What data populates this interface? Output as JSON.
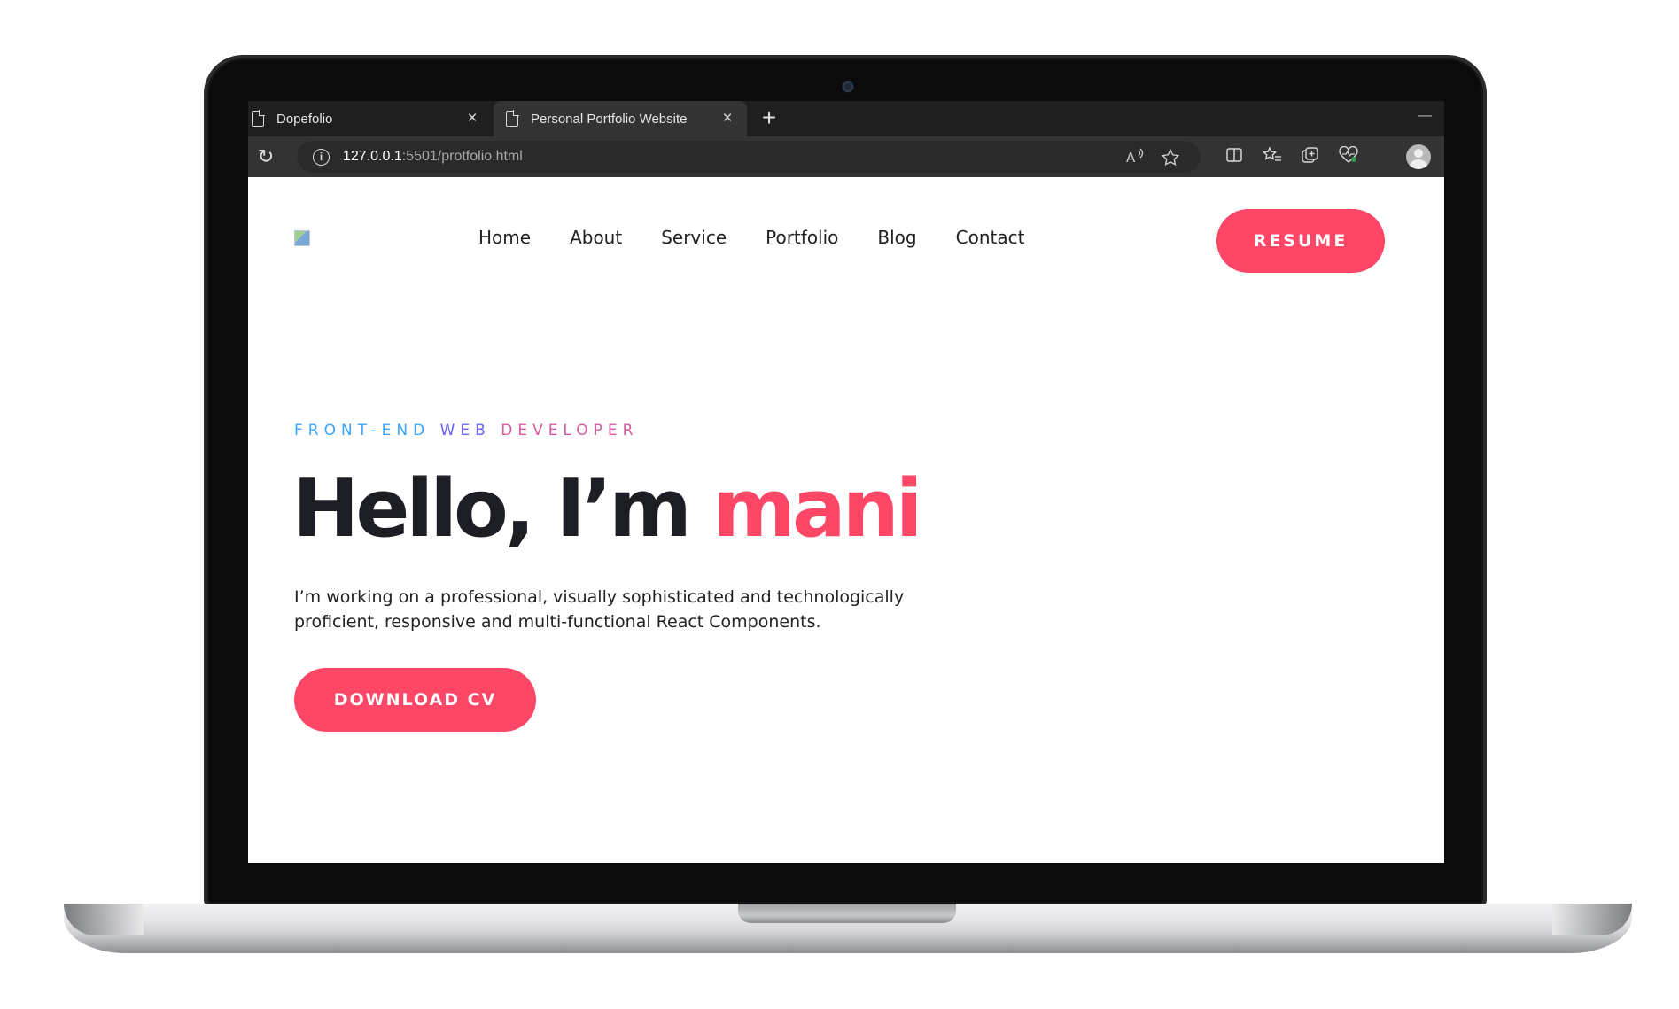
{
  "browser": {
    "tabs": [
      {
        "title": "Dopefolio",
        "close": "×"
      },
      {
        "title": "Personal Portfolio Website",
        "close": "×"
      }
    ],
    "new_tab": "+",
    "minimize": "—",
    "url": {
      "host": "127.0.0.1",
      "rest": ":5501/protfolio.html"
    },
    "reload_glyph": "↻",
    "info_glyph": "i",
    "icons": [
      "read-aloud-icon",
      "favorite-star-icon",
      "split-screen-icon",
      "favorites-list-icon",
      "collections-icon",
      "browser-essentials-icon",
      "profile-avatar-icon"
    ]
  },
  "site": {
    "nav": [
      "Home",
      "About",
      "Service",
      "Portfolio",
      "Blog",
      "Contact"
    ],
    "resume_button": "RESUME",
    "kicker": {
      "part1": "FRONT-END ",
      "part2": "WEB ",
      "part3": "DEVELOPER"
    },
    "hero": {
      "greeting": "Hello, I’m ",
      "name": "mani"
    },
    "description_line1": "I’m working on a professional, visually sophisticated and technologically",
    "description_line2": "proficient, responsive and multi-functional React Components.",
    "cv_button": "DOWNLOAD CV"
  },
  "colors": {
    "accent": "#fe4666",
    "heading": "#1d1d24",
    "browser_dark": "#1f1f1f",
    "kicker_blue": "#3ba6ff",
    "kicker_violet": "#6b63f0",
    "kicker_pink": "#d75b9e"
  }
}
